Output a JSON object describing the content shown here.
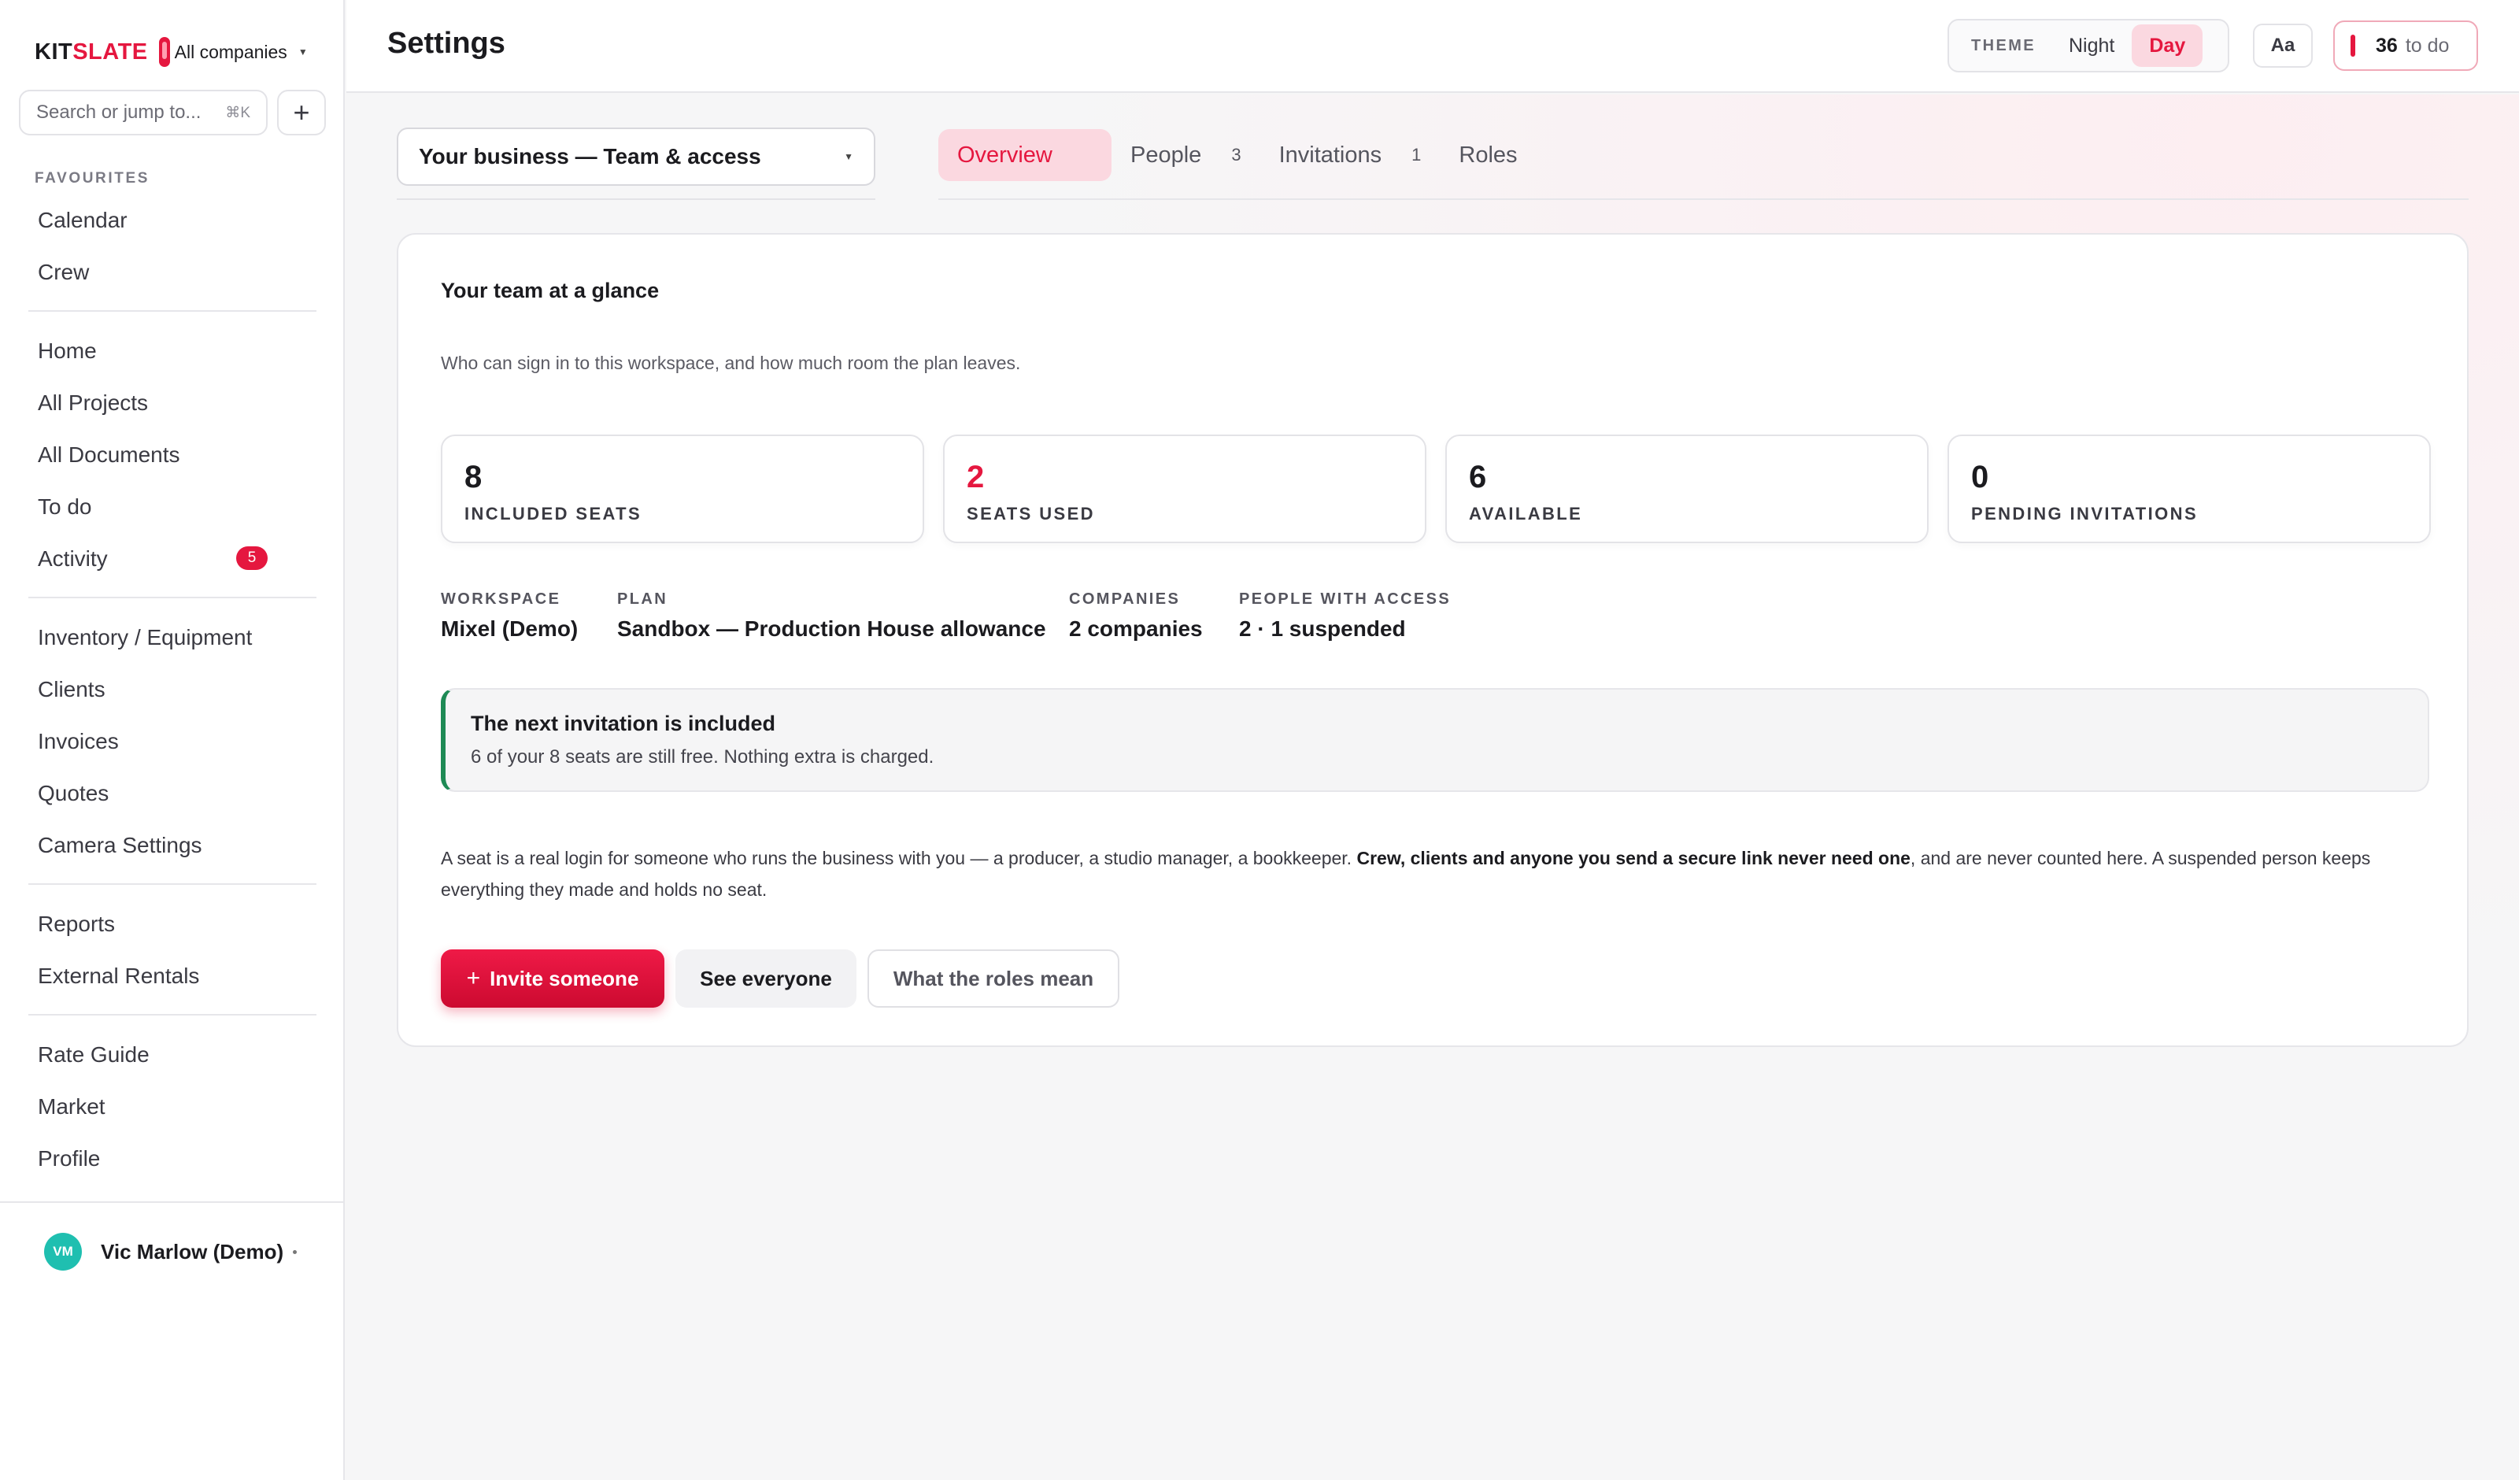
{
  "brand": {
    "name_part1": "KIT",
    "name_part2": "SLATE",
    "company_switch": "All companies"
  },
  "search": {
    "placeholder": "Search or jump to...",
    "shortcut": "⌘K"
  },
  "sidebar": {
    "favourites_label": "FAVOURITES",
    "favourites": [
      "Calendar",
      "Crew"
    ],
    "group1": [
      "Home",
      "All Projects",
      "All Documents",
      "To do",
      "Activity"
    ],
    "activity_badge": "5",
    "group2": [
      "Inventory / Equipment",
      "Clients",
      "Invoices",
      "Quotes",
      "Camera Settings"
    ],
    "group3": [
      "Reports",
      "External Rentals"
    ],
    "group4": [
      "Rate Guide",
      "Market",
      "Profile"
    ]
  },
  "user": {
    "initials": "VM",
    "name": "Vic Marlow (Demo)"
  },
  "header": {
    "title": "Settings",
    "theme_label": "THEME",
    "theme_options": [
      "Night",
      "Day"
    ],
    "theme_selected": "Day",
    "font_toggle": "Aa",
    "todo_count": "36",
    "todo_label": "to do"
  },
  "scope_select": {
    "value": "Your business — Team & access"
  },
  "tabs": [
    {
      "label": "Overview",
      "count": ""
    },
    {
      "label": "People",
      "count": "3"
    },
    {
      "label": "Invitations",
      "count": "1"
    },
    {
      "label": "Roles",
      "count": ""
    }
  ],
  "overview": {
    "title": "Your team at a glance",
    "subtitle": "Who can sign in to this workspace, and how much room the plan leaves.",
    "stats": [
      {
        "value": "8",
        "label": "INCLUDED SEATS"
      },
      {
        "value": "2",
        "label": "SEATS USED"
      },
      {
        "value": "6",
        "label": "AVAILABLE"
      },
      {
        "value": "0",
        "label": "PENDING INVITATIONS"
      }
    ],
    "meta": [
      {
        "label": "WORKSPACE",
        "value": "Mixel (Demo)"
      },
      {
        "label": "PLAN",
        "value": "Sandbox — Production House allowance"
      },
      {
        "label": "COMPANIES",
        "value": "2 companies"
      },
      {
        "label": "PEOPLE WITH ACCESS",
        "value": "2 · 1 suspended"
      }
    ],
    "callout": {
      "title": "The next invitation is included",
      "text": "6 of your 8 seats are still free. Nothing extra is charged."
    },
    "description": {
      "part1": "A seat is a real login for someone who runs the business with you — a producer, a studio manager, a bookkeeper. ",
      "bold": "Crew, clients and anyone you send a secure link never need one",
      "part2": ", and are never counted here. A suspended person keeps everything they made and holds no seat."
    },
    "actions": {
      "invite": "Invite someone",
      "see_everyone": "See everyone",
      "roles": "What the roles mean"
    }
  },
  "colors": {
    "accent": "#e5173f",
    "success": "#1e8a55",
    "avatar": "#1fbfb0"
  }
}
